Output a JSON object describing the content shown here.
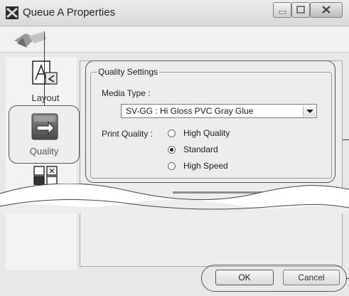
{
  "window": {
    "title": "Queue A Properties"
  },
  "nav": {
    "items": [
      {
        "label": "Layout",
        "icon": "layout-icon"
      },
      {
        "label": "Quality",
        "icon": "quality-icon",
        "selected": true
      },
      {
        "label": "",
        "icon": "color-icon"
      }
    ]
  },
  "quality_settings": {
    "group_title": "Quality Settings",
    "media_type_label": "Media Type :",
    "media_type_value": "SV-GG : Hi Gloss PVC Gray Glue",
    "print_quality_label": "Print Quality :",
    "options": [
      {
        "label": "High Quality",
        "checked": false
      },
      {
        "label": "Standard",
        "checked": true
      },
      {
        "label": "High Speed",
        "checked": false
      }
    ]
  },
  "buttons": {
    "ok_label": "OK",
    "cancel_label": "Cancel"
  },
  "colors": {
    "frame": "#e8e8e8",
    "panel": "#ededed",
    "highlight_border": "#555555"
  }
}
